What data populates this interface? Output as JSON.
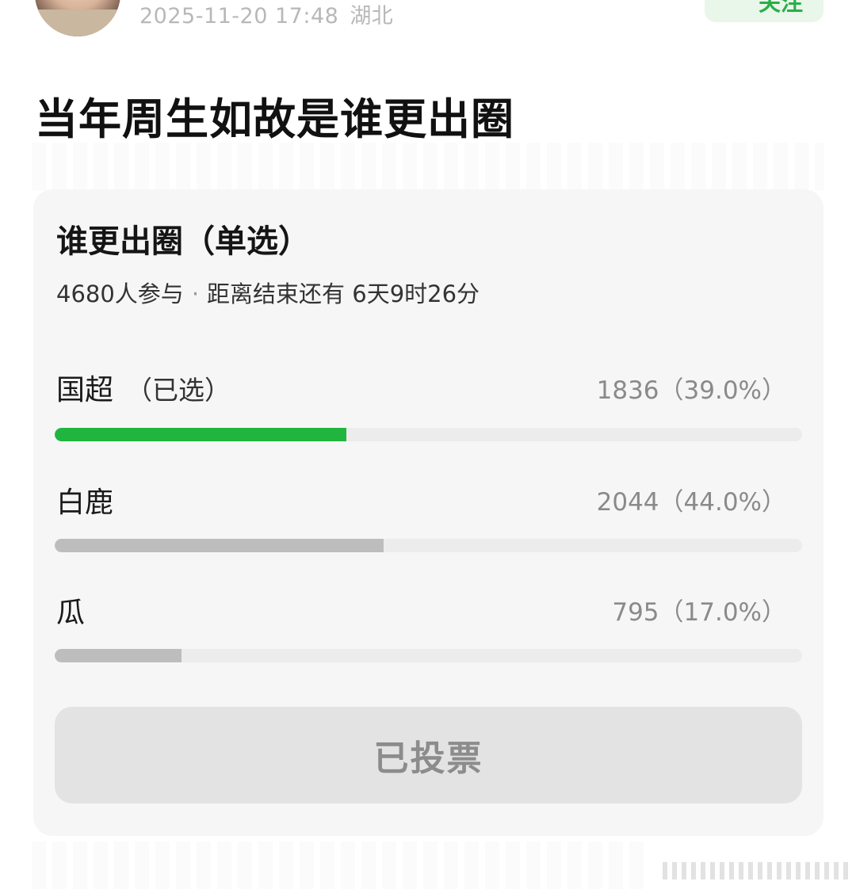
{
  "post": {
    "timestamp": "2025-11-20 17:48",
    "location": "湖北",
    "follow_label": "关注",
    "title": "当年周生如故是谁更出圈"
  },
  "poll": {
    "title": "谁更出圈（单选）",
    "participants": "4680人参与",
    "separator": "·",
    "deadline": "距离结束还有 6天9时26分",
    "options": [
      {
        "label": "国超",
        "selected_tag": "（已选）",
        "count": "1836（39.0%）",
        "percent": 39.0,
        "selected": true
      },
      {
        "label": "白鹿",
        "selected_tag": "",
        "count": "2044（44.0%）",
        "percent": 44.0,
        "selected": false
      },
      {
        "label": "瓜",
        "selected_tag": "",
        "count": "795（17.0%）",
        "percent": 17.0,
        "selected": false
      }
    ],
    "vote_button": "已投票"
  },
  "colors": {
    "selected_bar": "#1fb53f",
    "unselected_bar": "#bdbdbd",
    "accent_green": "#2aae4a"
  }
}
